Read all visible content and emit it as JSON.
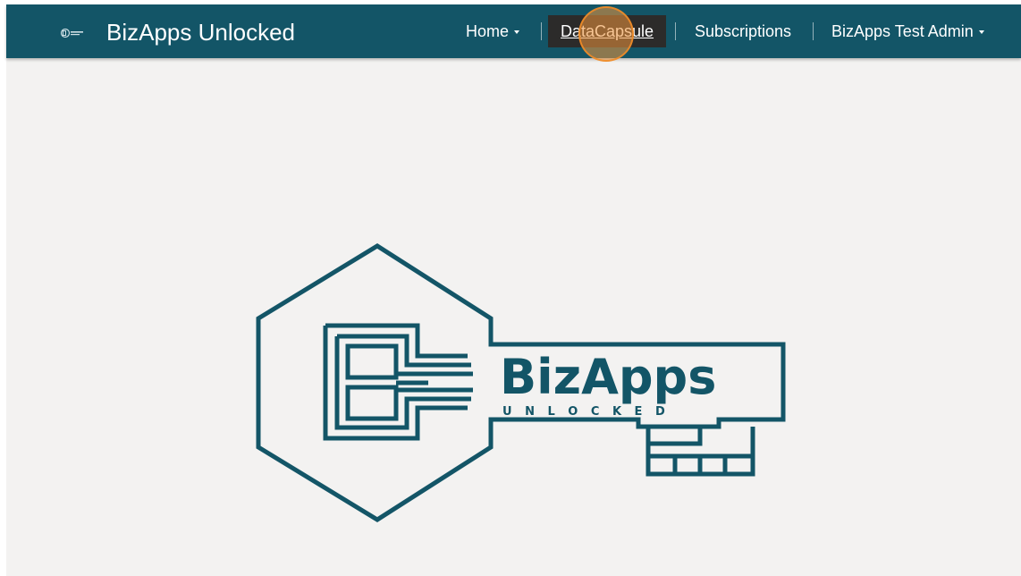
{
  "app": {
    "title": "BizApps Unlocked",
    "brand_color": "#135567",
    "brand_icon": "bizapps-key-icon"
  },
  "nav": {
    "items": [
      {
        "label": "Home",
        "dropdown": true
      },
      {
        "label": "DataCapsule",
        "dropdown": false,
        "active": true
      },
      {
        "label": "Subscriptions",
        "dropdown": false
      },
      {
        "label": "BizApps Test Admin",
        "dropdown": true
      }
    ]
  },
  "logo": {
    "name": "BizApps",
    "tagline": "U N L O C K E D",
    "color": "#135567"
  }
}
